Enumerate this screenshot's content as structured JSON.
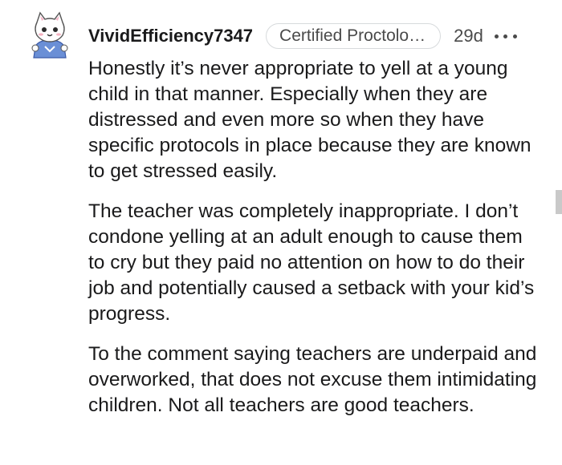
{
  "comment": {
    "avatar_icon": "cat-avatar-icon",
    "username": "VividEfficiency7347",
    "flair": "Certified Proctolo…",
    "timestamp": "29d",
    "more_icon": "more-horizontal-icon",
    "paragraphs": [
      "Honestly it’s never appropriate to yell at a young child in that manner. Especially when they are distressed and even more so when they have specific protocols in place because they are known to get stressed easily.",
      "The teacher was completely inappropriate. I don’t condone yelling at an adult enough to cause them to cry but they paid no attention on how to do their job and potentially caused a setback with your kid’s progress.",
      "To the comment saying teachers are underpaid and overworked, that does not excuse them intimidating children. Not all teachers are good teachers."
    ]
  },
  "colors": {
    "text": "#1a1a1b",
    "meta": "#4a4a4a",
    "flair_border": "#d7dadc",
    "scroll_indicator": "#c9c9c9"
  }
}
